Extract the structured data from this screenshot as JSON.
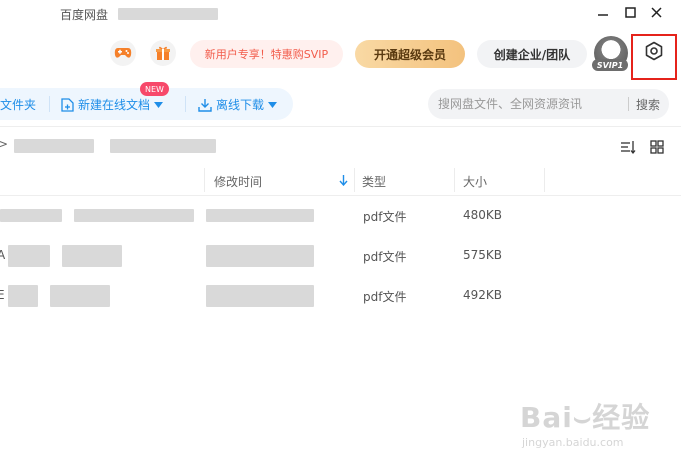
{
  "window": {
    "title": "百度网盘"
  },
  "header": {
    "promo_label": "新用户专享！特惠购SVIP",
    "vip_label": "开通超级会员",
    "business_label": "创建企业/团队",
    "svip_badge": "SVIP1"
  },
  "toolbar": {
    "new_folder_label": "文件夹",
    "new_doc_label": "新建在线文档",
    "new_badge": "NEW",
    "offline_download_label": "离线下载",
    "search_placeholder": "搜网盘文件、全网资源资讯",
    "search_button": "搜索"
  },
  "path": {
    "arrow": ">"
  },
  "table": {
    "columns": {
      "modified": "修改时间",
      "type": "类型",
      "size": "大小"
    },
    "rows": [
      {
        "prefix": "",
        "type": "pdf文件",
        "size": "480KB"
      },
      {
        "prefix": "A",
        "type": "pdf文件",
        "size": "575KB"
      },
      {
        "prefix": "E",
        "type": "pdf文件",
        "size": "492KB"
      }
    ]
  },
  "watermark": {
    "brand": "Bai⌣经验",
    "url": "jingyan.baidu.com"
  },
  "colors": {
    "accent_blue": "#1f8ee8",
    "highlight_red": "#e5231b",
    "vip_gold": "#f3c27e",
    "promo_red": "#f25b4a"
  }
}
